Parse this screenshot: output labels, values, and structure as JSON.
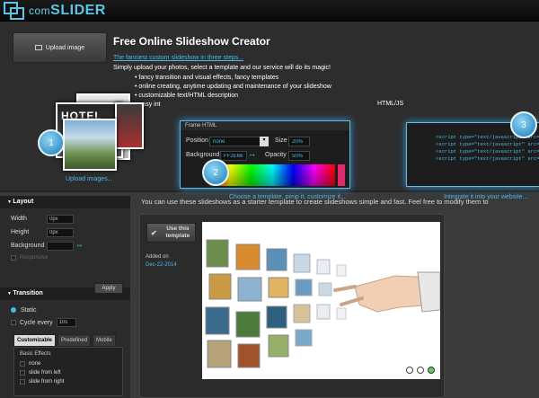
{
  "brand": {
    "prefix": "com",
    "name": "SLIDER"
  },
  "hero": {
    "upload_button": "Upload image",
    "title": "Free Online Slideshow Creator",
    "subtitle": "The fanciest custom slideshow in three steps...",
    "description": "Simply upload your photos, select a template and our service will do its magic!",
    "features": [
      "fancy transition and visual effects, fancy templates",
      "online creating, anytime updating and maintenance of your slideshow",
      "customizable text/HTML description",
      "easy int"
    ],
    "html_label": "HTML/JS",
    "steps": [
      {
        "number": "1",
        "caption": "Upload images..."
      },
      {
        "number": "2",
        "caption": "Choose a template, pimp it, customize it..."
      },
      {
        "number": "3",
        "caption": "Integrate it into your website..."
      }
    ],
    "frame_panel": {
      "header": "Frame HTML",
      "position_label": "Position",
      "position_value": "none",
      "size_label": "Size",
      "size_value": "20%",
      "background_label": "Background",
      "background_value": "FF2E66",
      "opacity_label": "Opacity",
      "opacity_value": "50%"
    },
    "code_lines": [
      "<script type=\"text/javascript\" src=",
      "<script type=\"text/javascript\" src=\"js/",
      "<script type=\"text/javascript\" src=\"js/jqu",
      "<script type=\"text/javascript\" src=\"js/jqu"
    ]
  },
  "sidebar": {
    "layout": {
      "title": "Layout",
      "width_label": "Width",
      "width_value": "0px",
      "height_label": "Height",
      "height_value": "0px",
      "background_label": "Background",
      "responsive_label": "Responsive",
      "apply_label": "Apply"
    },
    "transition": {
      "title": "Transition",
      "static_label": "Static",
      "cycle_label": "Cycle every",
      "cycle_value": "10s",
      "tabs": [
        "Customizable",
        "Predefined",
        "Mobile"
      ],
      "effects_title": "Basic Effects",
      "effects": [
        "none",
        "slide from left",
        "slide from right"
      ]
    }
  },
  "main": {
    "note": "You can use these slideshows as a starter template to create slideshows simple and fast. Feel free to modify them to",
    "card": {
      "use_label": "Use this template",
      "added_label": "Added on",
      "added_date": "Dec-22-2014"
    }
  },
  "colors": {
    "accent": "#49b9e6",
    "background": "#3a3a3a",
    "active_dot": "#55d45c",
    "hue_selected": "#e02b6b"
  }
}
